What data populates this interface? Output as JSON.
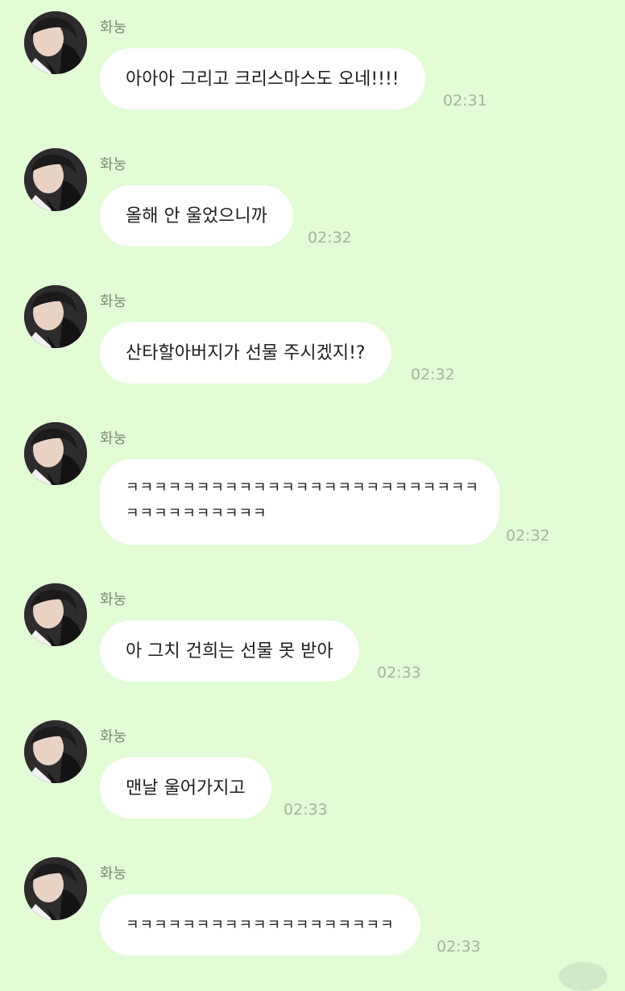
{
  "chat": {
    "sender_name": "화눙",
    "messages": [
      {
        "text": "아아아 그리고 크리스마스도 오네!!!!",
        "time": "02:31"
      },
      {
        "text": "올해 안 울었으니까",
        "time": "02:32"
      },
      {
        "text": "산타할아버지가 선물 주시겠지!?",
        "time": "02:32"
      },
      {
        "text_line1": "ㅋㅋㅋㅋㅋㅋㅋㅋㅋㅋㅋㅋㅋㅋㅋㅋㅋㅋㅋㅋㅋㅋㅋㅋㅋ",
        "text_line2": "ㅋㅋㅋㅋㅋㅋㅋㅋㅋㅋ",
        "time": "02:32"
      },
      {
        "text": "아 그치 건희는 선물 못 받아",
        "time": "02:33"
      },
      {
        "text": "맨날 울어가지고",
        "time": "02:33"
      },
      {
        "text": "ㅋㅋㅋㅋㅋㅋㅋㅋㅋㅋㅋㅋㅋㅋㅋㅋㅋㅋㅋ",
        "time": "02:33"
      }
    ]
  },
  "colors": {
    "background": "#e2fcd6",
    "bubble": "#ffffff",
    "name_text": "#7d8a74",
    "time_text": "#a6b39c"
  },
  "icons": {
    "avatar": "profile-photo"
  }
}
